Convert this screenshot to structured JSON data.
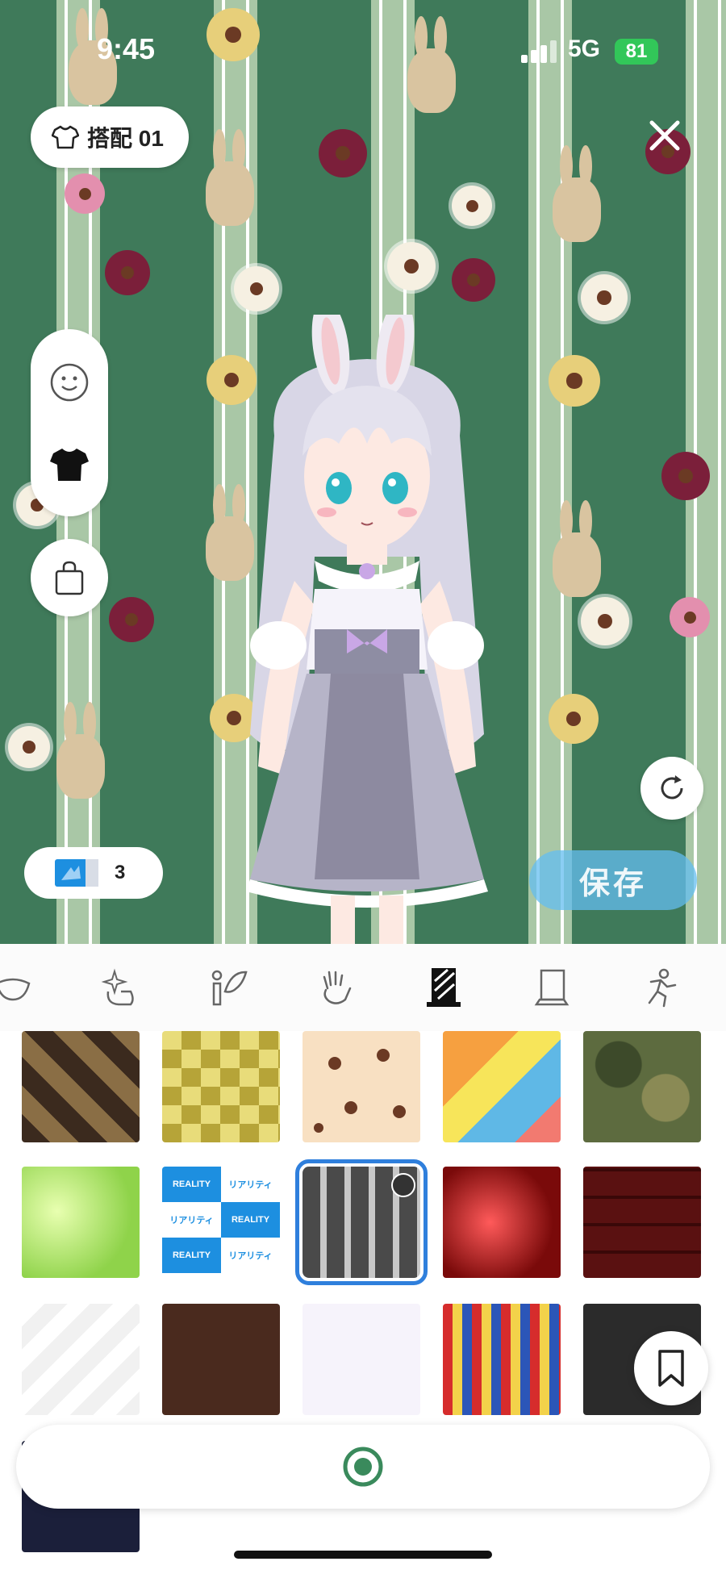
{
  "status_bar": {
    "time": "9:45",
    "network": "5G",
    "battery": "81"
  },
  "outfit": {
    "label": "搭配 01"
  },
  "ticket": {
    "count": "3"
  },
  "save": {
    "label": "保存"
  },
  "tabs": [
    {
      "name": "face-tab",
      "icon": "mouth-icon"
    },
    {
      "name": "effect-tab",
      "icon": "sparkle-hand-icon"
    },
    {
      "name": "wings-tab",
      "icon": "wings-icon"
    },
    {
      "name": "hand-tab",
      "icon": "hand-icon"
    },
    {
      "name": "background-tab",
      "icon": "background-icon",
      "selected": true
    },
    {
      "name": "stand-tab",
      "icon": "stand-icon"
    },
    {
      "name": "pose-tab",
      "icon": "pose-icon"
    }
  ],
  "grid": {
    "reality_labels": [
      "REALITY",
      "リアリティ"
    ],
    "items": [
      "argyle",
      "yellow-check",
      "paw-prints",
      "triangles",
      "camouflage",
      "green-bokeh",
      "reality-logo",
      "bunny-stripes",
      "red-bokeh",
      "dark-frames",
      "medical",
      "curio-shelf",
      "game-pastel",
      "circus-stripes",
      "dark-kitchen",
      "night-sky"
    ]
  },
  "colors": {
    "accent": "#2f7fdc",
    "save": "#64bef0",
    "record": "#3a8a5c"
  }
}
